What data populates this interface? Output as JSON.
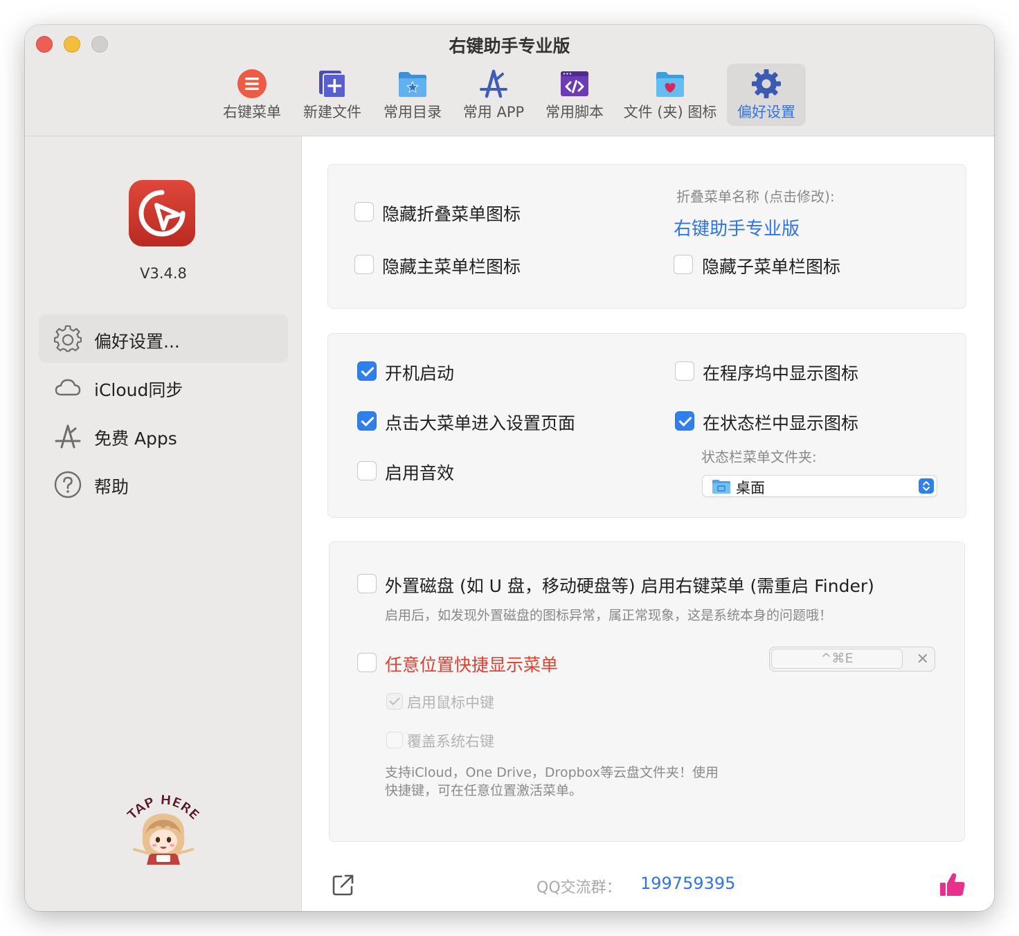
{
  "window": {
    "title": "右键助手专业版"
  },
  "toolbar": {
    "items": [
      {
        "label": "右键菜单",
        "icon": "list-circle-icon"
      },
      {
        "label": "新建文件",
        "icon": "new-file-icon"
      },
      {
        "label": "常用目录",
        "icon": "folder-star-icon"
      },
      {
        "label": "常用 APP",
        "icon": "app-store-icon"
      },
      {
        "label": "常用脚本",
        "icon": "script-icon"
      },
      {
        "label": "文件 (夹) 图标",
        "icon": "folder-heart-icon"
      },
      {
        "label": "偏好设置",
        "icon": "gear-icon",
        "active": true
      }
    ]
  },
  "sidebar": {
    "version": "V3.4.8",
    "items": [
      {
        "label": "偏好设置...",
        "icon": "gear-outline-icon",
        "active": true
      },
      {
        "label": "iCloud同步",
        "icon": "cloud-icon"
      },
      {
        "label": "免费 Apps",
        "icon": "app-store-outline-icon"
      },
      {
        "label": "帮助",
        "icon": "question-icon"
      }
    ],
    "mascot_text": "TAP HERE"
  },
  "panel1": {
    "hide_fold_icon": {
      "label": "隐藏折叠菜单图标",
      "checked": false
    },
    "hide_main_icon": {
      "label": "隐藏主菜单栏图标",
      "checked": false
    },
    "fold_name_caption": "折叠菜单名称 (点击修改):",
    "fold_name_value": "右键助手专业版",
    "hide_sub_icon": {
      "label": "隐藏子菜单栏图标",
      "checked": false
    }
  },
  "panel2": {
    "launch_at_login": {
      "label": "开机启动",
      "checked": true
    },
    "click_big_menu": {
      "label": "点击大菜单进入设置页面",
      "checked": true
    },
    "enable_sound": {
      "label": "启用音效",
      "checked": false
    },
    "show_in_dock": {
      "label": "在程序坞中显示图标",
      "checked": false
    },
    "show_in_statusbar": {
      "label": "在状态栏中显示图标",
      "checked": true
    },
    "statusbar_folder_caption": "状态栏菜单文件夹:",
    "statusbar_folder_value": "桌面"
  },
  "panel3": {
    "external_disk": {
      "label": "外置磁盘 (如 U 盘，移动硬盘等) 启用右键菜单 (需重启 Finder)",
      "checked": false
    },
    "external_disk_note": "启用后，如发现外置磁盘的图标异常，属正常现象，这是系统本身的问题哦！",
    "anywhere_menu": {
      "label": "任意位置快捷显示菜单",
      "checked": false
    },
    "shortcut_value": "^⌘E",
    "shortcut_clear": "✕",
    "middle_click": {
      "label": "启用鼠标中键",
      "checked": true,
      "disabled": true
    },
    "override_right": {
      "label": "覆盖系统右键",
      "checked": false,
      "disabled": true
    },
    "note_line1": "支持iCloud，One Drive，Dropbox等云盘文件夹！使用",
    "note_line2": "快捷键，可在任意位置激活菜单。"
  },
  "footer": {
    "qq_label": "QQ交流群：",
    "qq_number": "199759395"
  },
  "colors": {
    "accent": "#2f74e6",
    "checkbox_blue": "#2f80ed",
    "warning_red": "#e0402f",
    "traffic_close": "#ee5e56",
    "traffic_min": "#f4bd3b",
    "like_pink": "#e8318c"
  }
}
